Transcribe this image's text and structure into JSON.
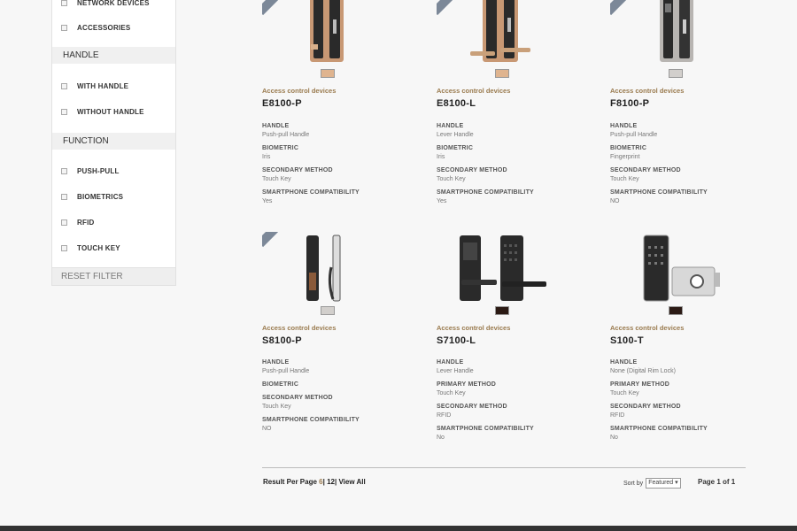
{
  "sidebar": {
    "type_items": [
      "NETWORK DEVICES",
      "ACCESSORIES"
    ],
    "handle_title": "HANDLE",
    "handle_items": [
      "WITH HANDLE",
      "WITHOUT HANDLE"
    ],
    "function_title": "FUNCTION",
    "function_items": [
      "PUSH-PULL",
      "BIOMETRICS",
      "RFID",
      "TOUCH KEY"
    ],
    "reset_label": "RESET FILTER"
  },
  "products": [
    {
      "category": "Access control devices",
      "model": "E8100-P",
      "swatch": "#dfb48f",
      "specs": [
        {
          "label": "HANDLE",
          "value": "Push-pull Handle"
        },
        {
          "label": "BIOMETRIC",
          "value": "Iris"
        },
        {
          "label": "SECONDARY METHOD",
          "value": "Touch Key"
        },
        {
          "label": "SMARTPHONE COMPATIBILITY",
          "value": "Yes"
        }
      ]
    },
    {
      "category": "Access control devices",
      "model": "E8100-L",
      "swatch": "#dfb48f",
      "specs": [
        {
          "label": "HANDLE",
          "value": "Lever Handle"
        },
        {
          "label": "BIOMETRIC",
          "value": "Iris"
        },
        {
          "label": "SECONDARY METHOD",
          "value": "Touch Key"
        },
        {
          "label": "SMARTPHONE COMPATIBILITY",
          "value": "Yes"
        }
      ]
    },
    {
      "category": "Access control devices",
      "model": "F8100-P",
      "swatch": "#d2cfcc",
      "specs": [
        {
          "label": "HANDLE",
          "value": "Push-pull Handle"
        },
        {
          "label": "BIOMETRIC",
          "value": "Fingerprint"
        },
        {
          "label": "SECONDARY METHOD",
          "value": "Touch Key"
        },
        {
          "label": "SMARTPHONE COMPATIBILITY",
          "value": "NO"
        }
      ]
    },
    {
      "category": "Access control devices",
      "model": "S8100-P",
      "swatch": "#d2cfcc",
      "specs": [
        {
          "label": "HANDLE",
          "value": "Push-pull Handle"
        },
        {
          "label": "BIOMETRIC",
          "value": ""
        },
        {
          "label": "SECONDARY METHOD",
          "value": "Touch Key"
        },
        {
          "label": "SMARTPHONE COMPATIBILITY",
          "value": "NO"
        }
      ]
    },
    {
      "category": "Access control devices",
      "model": "S7100-L",
      "swatch": "#2b1a14",
      "specs": [
        {
          "label": "HANDLE",
          "value": "Lever Handle"
        },
        {
          "label": "PRIMARY METHOD",
          "value": "Touch Key"
        },
        {
          "label": "SECONDARY METHOD",
          "value": "RFID"
        },
        {
          "label": "SMARTPHONE COMPATIBILITY",
          "value": "No"
        }
      ]
    },
    {
      "category": "Access control devices",
      "model": "S100-T",
      "swatch": "#2b1a14",
      "specs": [
        {
          "label": "HANDLE",
          "value": "None (Digital Rim Lock)"
        },
        {
          "label": "PRIMARY METHOD",
          "value": "Touch Key"
        },
        {
          "label": "SECONDARY METHOD",
          "value": "RFID"
        },
        {
          "label": "SMARTPHONE COMPATIBILITY",
          "value": "No"
        }
      ]
    }
  ],
  "pager": {
    "rpp_label": "Result Per Page",
    "opt_6": "6",
    "opt_12": "12",
    "view_all": "View All",
    "sort_label": "Sort by",
    "sort_value": "Featured",
    "page_info": "Page 1 of 1"
  }
}
